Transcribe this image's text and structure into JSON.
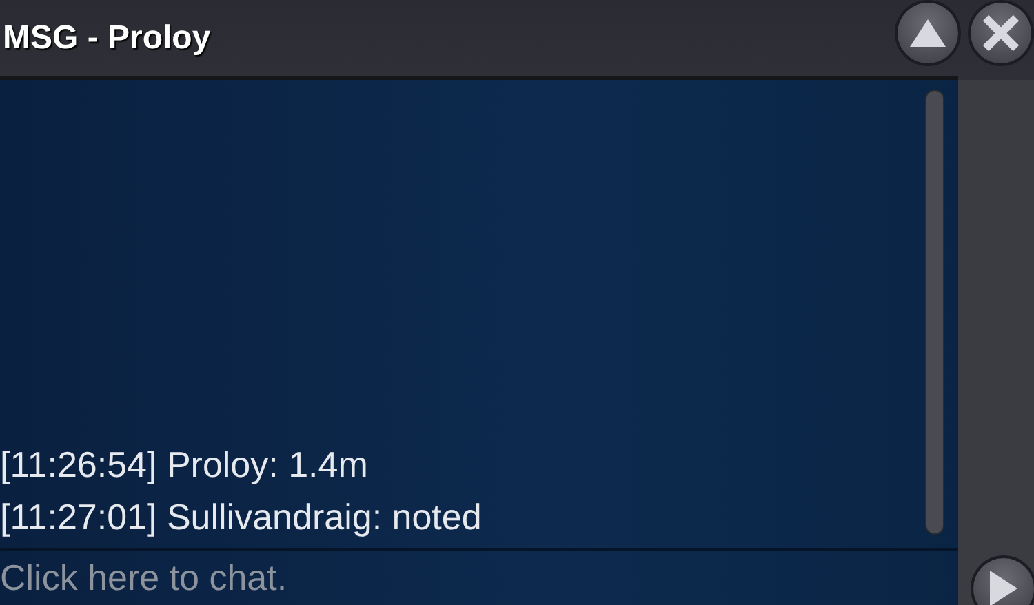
{
  "window": {
    "title": "MSG - Proloy"
  },
  "messages": [
    "[11:26:54] Proloy: 1.4m",
    "[11:27:01] Sullivandraig: noted"
  ],
  "chat_input": {
    "placeholder": "Click here to chat."
  }
}
